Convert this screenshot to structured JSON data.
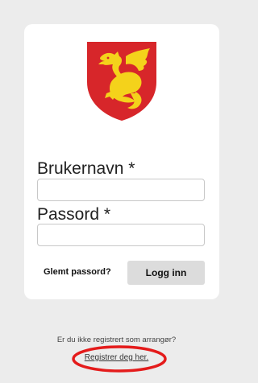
{
  "crest": {
    "icon": "dragon-crest-icon",
    "shield_color": "#d7262a",
    "dragon_color": "#f4d21b"
  },
  "login": {
    "username_label": "Brukernavn *",
    "username_value": "",
    "password_label": "Passord *",
    "password_value": "",
    "forgot_password": "Glemt passord?",
    "login_button": "Logg inn"
  },
  "footer": {
    "not_registered_text": "Er du ikke registrert som arrangør?",
    "register_link": "Registrer deg her."
  },
  "annotation": {
    "highlight_color": "#e41b1b"
  }
}
